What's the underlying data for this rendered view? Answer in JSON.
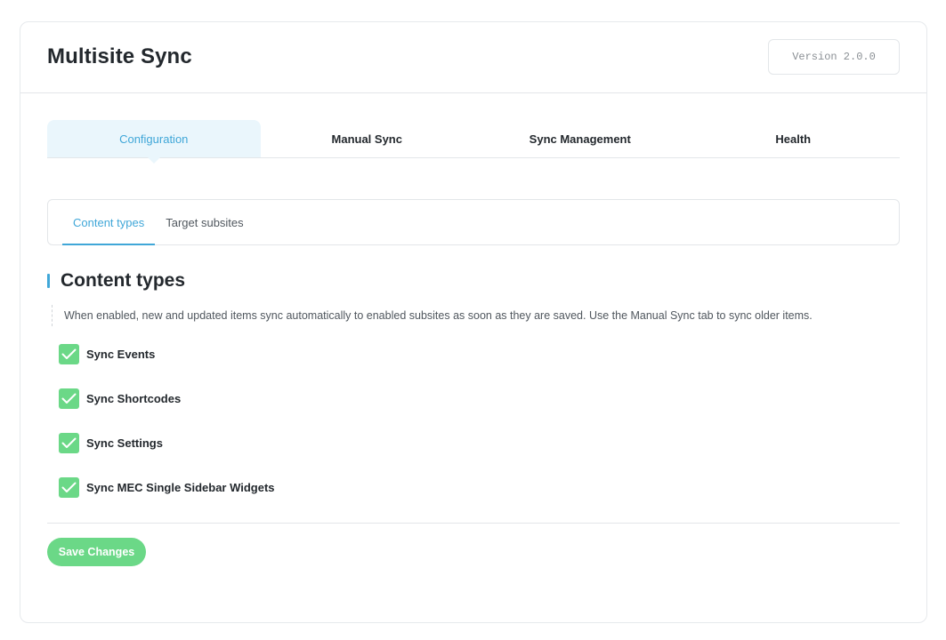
{
  "header": {
    "title": "Multisite Sync",
    "version": "Version 2.0.0"
  },
  "main_tabs": [
    {
      "label": "Configuration",
      "active": true
    },
    {
      "label": "Manual Sync",
      "active": false
    },
    {
      "label": "Sync Management",
      "active": false
    },
    {
      "label": "Health",
      "active": false
    }
  ],
  "sub_tabs": [
    {
      "label": "Content types",
      "active": true
    },
    {
      "label": "Target subsites",
      "active": false
    }
  ],
  "section": {
    "title": "Content types",
    "description": "When enabled, new and updated items sync automatically to enabled subsites as soon as they are saved. Use the Manual Sync tab to sync older items."
  },
  "options": [
    {
      "label": "Sync Events",
      "checked": true
    },
    {
      "label": "Sync Shortcodes",
      "checked": true
    },
    {
      "label": "Sync Settings",
      "checked": true
    },
    {
      "label": "Sync MEC Single Sidebar Widgets",
      "checked": true
    }
  ],
  "actions": {
    "save_label": "Save Changes"
  },
  "colors": {
    "accent": "#40a7d8",
    "active_tab_bg": "#eaf6fc",
    "success": "#6bd887"
  },
  "icons": {
    "checkbox": "checkmark-icon"
  }
}
